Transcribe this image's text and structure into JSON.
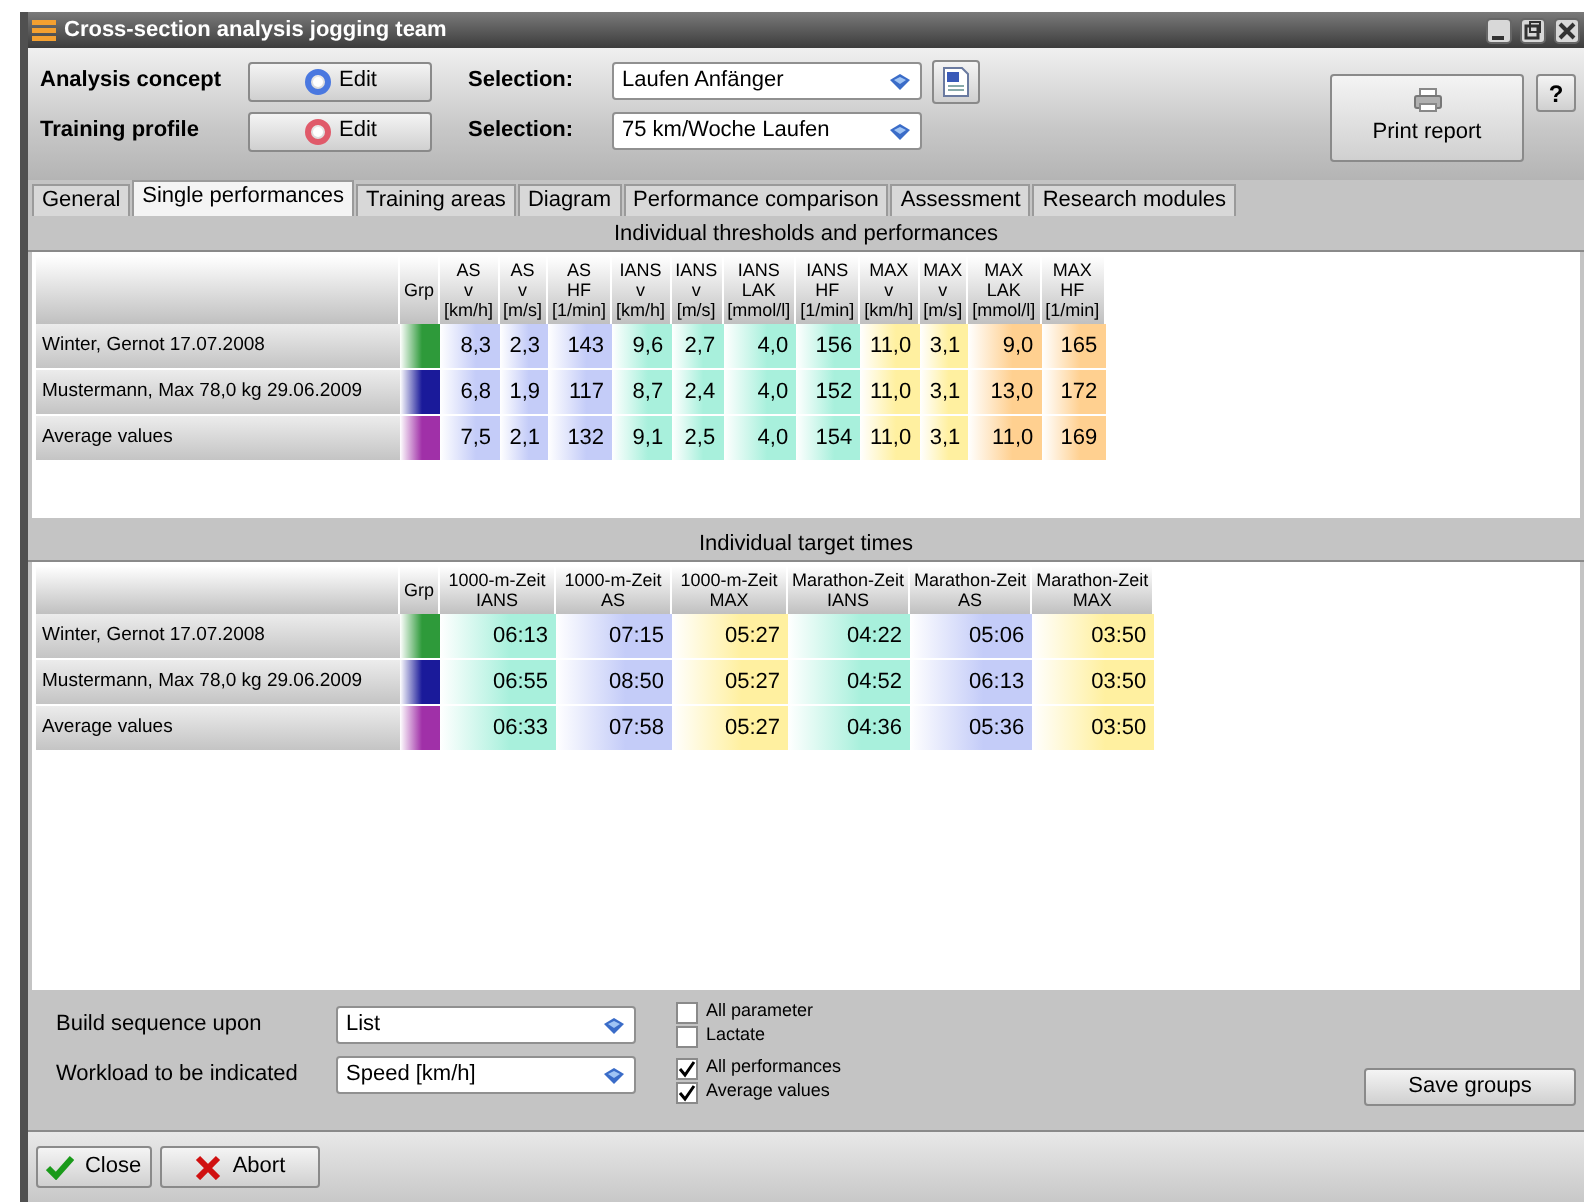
{
  "window": {
    "title": "Cross-section analysis jogging team"
  },
  "header": {
    "rows": [
      {
        "label": "Analysis concept",
        "edit": "Edit",
        "color": "#4a78e0",
        "selection_label": "Selection:",
        "selection": "Laufen Anfänger",
        "export": true
      },
      {
        "label": "Training profile",
        "edit": "Edit",
        "color": "#e05a6a",
        "selection_label": "Selection:",
        "selection": "75 km/Woche Laufen",
        "export": false
      }
    ],
    "print": "Print report",
    "help": "?"
  },
  "tabs": [
    {
      "label": "General",
      "selected": false
    },
    {
      "label": "Single performances",
      "selected": true
    },
    {
      "label": "Training areas",
      "selected": false
    },
    {
      "label": "Diagram",
      "selected": false
    },
    {
      "label": "Performance comparison",
      "selected": false
    },
    {
      "label": "Assessment",
      "selected": false
    },
    {
      "label": "Research modules",
      "selected": false
    }
  ],
  "sections": [
    {
      "title": "Individual thresholds and performances",
      "grp": "Grp",
      "columns": [
        {
          "lines": [
            "AS",
            "v",
            "[km/h]"
          ],
          "color": "#c4ccf8"
        },
        {
          "lines": [
            "AS",
            "v",
            "[m/s]"
          ],
          "color": "#c4ccf8"
        },
        {
          "lines": [
            "AS",
            "HF",
            "[1/min]"
          ],
          "color": "#c4ccf8"
        },
        {
          "lines": [
            "IANS",
            "v",
            "[km/h]"
          ],
          "color": "#a8f0dc"
        },
        {
          "lines": [
            "IANS",
            "v",
            "[m/s]"
          ],
          "color": "#a8f0dc"
        },
        {
          "lines": [
            "IANS",
            "LAK",
            "[mmol/l]"
          ],
          "color": "#a8f0dc"
        },
        {
          "lines": [
            "IANS",
            "HF",
            "[1/min]"
          ],
          "color": "#a8f0dc"
        },
        {
          "lines": [
            "MAX",
            "v",
            "[km/h]"
          ],
          "color": "#fff0a0"
        },
        {
          "lines": [
            "MAX",
            "v",
            "[m/s]"
          ],
          "color": "#fff0a0"
        },
        {
          "lines": [
            "MAX",
            "LAK",
            "[mmol/l]"
          ],
          "color": "#ffd090"
        },
        {
          "lines": [
            "MAX",
            "HF",
            "[1/min]"
          ],
          "color": "#ffd090"
        }
      ],
      "rows": [
        {
          "label": "Winter, Gernot 17.07.2008",
          "color": "#2e9a3a",
          "values": [
            "8,3",
            "2,3",
            "143",
            "9,6",
            "2,7",
            "4,0",
            "156",
            "11,0",
            "3,1",
            "9,0",
            "165"
          ]
        },
        {
          "label": "Mustermann, Max 78,0 kg 29.06.2009",
          "color": "#1a1a9a",
          "values": [
            "6,8",
            "1,9",
            "117",
            "8,7",
            "2,4",
            "4,0",
            "152",
            "11,0",
            "3,1",
            "13,0",
            "172"
          ]
        },
        {
          "label": "Average values",
          "color": "#a030a8",
          "values": [
            "7,5",
            "2,1",
            "132",
            "9,1",
            "2,5",
            "4,0",
            "154",
            "11,0",
            "3,1",
            "11,0",
            "169"
          ]
        }
      ]
    },
    {
      "title": "Individual target times",
      "grp": "Grp",
      "columns": [
        {
          "lines": [
            "1000-m-Zeit",
            "IANS"
          ],
          "color": "#a8f0dc"
        },
        {
          "lines": [
            "1000-m-Zeit",
            "AS"
          ],
          "color": "#c4ccf8"
        },
        {
          "lines": [
            "1000-m-Zeit",
            "MAX"
          ],
          "color": "#fff0a0"
        },
        {
          "lines": [
            "Marathon-Zeit",
            "IANS"
          ],
          "color": "#a8f0dc"
        },
        {
          "lines": [
            "Marathon-Zeit",
            "AS"
          ],
          "color": "#c4ccf8"
        },
        {
          "lines": [
            "Marathon-Zeit",
            "MAX"
          ],
          "color": "#fff0a0"
        }
      ],
      "rows": [
        {
          "label": "Winter, Gernot 17.07.2008",
          "color": "#2e9a3a",
          "values": [
            "06:13",
            "07:15",
            "05:27",
            "04:22",
            "05:06",
            "03:50"
          ]
        },
        {
          "label": "Mustermann, Max 78,0 kg 29.06.2009",
          "color": "#1a1a9a",
          "values": [
            "06:55",
            "08:50",
            "05:27",
            "04:52",
            "06:13",
            "03:50"
          ]
        },
        {
          "label": "Average values",
          "color": "#a030a8",
          "values": [
            "06:33",
            "07:58",
            "05:27",
            "04:36",
            "05:36",
            "03:50"
          ]
        }
      ]
    }
  ],
  "options": {
    "selects": [
      {
        "label": "Build sequence upon",
        "value": "List"
      },
      {
        "label": "Workload to be indicated",
        "value": "Speed [km/h]"
      }
    ],
    "checkboxes": [
      {
        "label": "All parameter",
        "checked": false
      },
      {
        "label": "Lactate",
        "checked": false
      },
      {
        "label": "All performances",
        "checked": true
      },
      {
        "label": "Average values",
        "checked": true
      }
    ],
    "save": "Save groups"
  },
  "footer": [
    {
      "label": "Close",
      "kind": "ok"
    },
    {
      "label": "Abort",
      "kind": "cancel"
    }
  ]
}
